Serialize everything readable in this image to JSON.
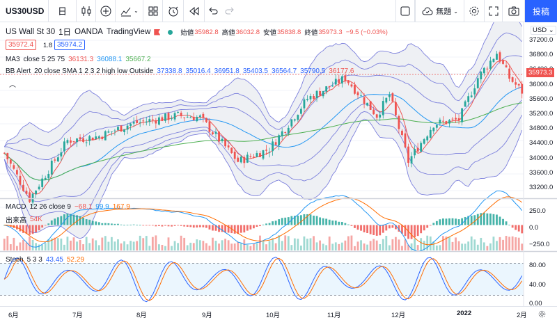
{
  "toolbar": {
    "symbol": "US30USD",
    "interval": "日",
    "untitled_label": "無題",
    "post_button": "投稿"
  },
  "legend": {
    "title": "US Wall St 30",
    "interval": "1日",
    "broker": "OANDA",
    "source": "TradingView",
    "open_label": "始値",
    "open": "35982.8",
    "high_label": "高値",
    "high": "36032.8",
    "low_label": "安値",
    "low": "35838.8",
    "close_label": "終値",
    "close": "35973.3",
    "change": "−9.5 (−0.03%)",
    "sell_price": "35972.4",
    "spread": "1.8",
    "buy_price": "35974.2",
    "ma3_name": "MA3",
    "ma3_params": "close 5 25 75",
    "ma3_values": [
      "36131.3",
      "36088.1",
      "35667.2"
    ],
    "bb_name": "BB Alert",
    "bb_params": "20 close SMA 1 2 3 2 high low Outside",
    "bb_values": [
      "37338.8",
      "35016.4",
      "36951.8",
      "35403.5",
      "36564.7",
      "35790.5",
      "36177.6"
    ],
    "macd_name": "MACD",
    "macd_params": "12 26 close 9",
    "macd_values": [
      "−68.1",
      "99.9",
      "167.9"
    ],
    "volume_label": "出来高",
    "volume_value": "54K",
    "stoch_name": "Stoch",
    "stoch_params": "5 3 3",
    "stoch_values": [
      "43.45",
      "52.29"
    ]
  },
  "price_axis": {
    "currency": "USD",
    "ticks": [
      "37200.0",
      "36800.0",
      "36400.0",
      "36000.0",
      "35600.0",
      "35200.0",
      "34800.0",
      "34400.0",
      "34000.0",
      "33600.0",
      "33200.0"
    ],
    "current_price": "35973.3"
  },
  "macd_axis": {
    "ticks": [
      "250.0",
      "0.0",
      "−250.0"
    ]
  },
  "stoch_axis": {
    "ticks": [
      "80.00",
      "40.00",
      "0.00"
    ]
  },
  "time_axis": {
    "labels": [
      "6月",
      "7月",
      "8月",
      "9月",
      "10月",
      "11月",
      "12月",
      "2022",
      "2月"
    ]
  },
  "colors": {
    "up": "#26a69a",
    "down": "#ef5350",
    "bb_band": "#7b7fdc",
    "ma_fast": "#ef5350",
    "ma_mid": "#2196f3",
    "ma_slow": "#4caf50",
    "macd_line": "#2196f3",
    "signal_line": "#ff6d00",
    "stoch_k": "#2962ff",
    "stoch_d": "#ff6d00",
    "accent": "#2962ff"
  },
  "chart_data": {
    "type": "candlestick",
    "symbol": "US30USD",
    "interval": "1日",
    "y_range": [
      33100,
      37300
    ],
    "overlays": [
      "MA 5/25/75",
      "Bollinger Bands 20 (1,2,3σ)"
    ],
    "close_path_approx": [
      {
        "x": "6月",
        "y": 34500
      },
      {
        "x": "6月中",
        "y": 33400
      },
      {
        "x": "7月",
        "y": 34800
      },
      {
        "x": "7月中",
        "y": 34900
      },
      {
        "x": "8月",
        "y": 35200
      },
      {
        "x": "8月中",
        "y": 35400
      },
      {
        "x": "9月",
        "y": 35350
      },
      {
        "x": "9月下",
        "y": 34300
      },
      {
        "x": "10月",
        "y": 34600
      },
      {
        "x": "10月下",
        "y": 35800
      },
      {
        "x": "11月",
        "y": 36300
      },
      {
        "x": "11月末",
        "y": 34500
      },
      {
        "x": "12月",
        "y": 35200
      },
      {
        "x": "12月下",
        "y": 36300
      },
      {
        "x": "2022",
        "y": 36800
      },
      {
        "x": "1月中",
        "y": 35973
      }
    ],
    "macd": {
      "macd": -68.1,
      "signal": 99.9,
      "hist": 167.9,
      "y_range": [
        -300,
        300
      ]
    },
    "stoch": {
      "k": 43.45,
      "d": 52.29,
      "levels": [
        80,
        20
      ],
      "y_range": [
        0,
        100
      ]
    }
  }
}
